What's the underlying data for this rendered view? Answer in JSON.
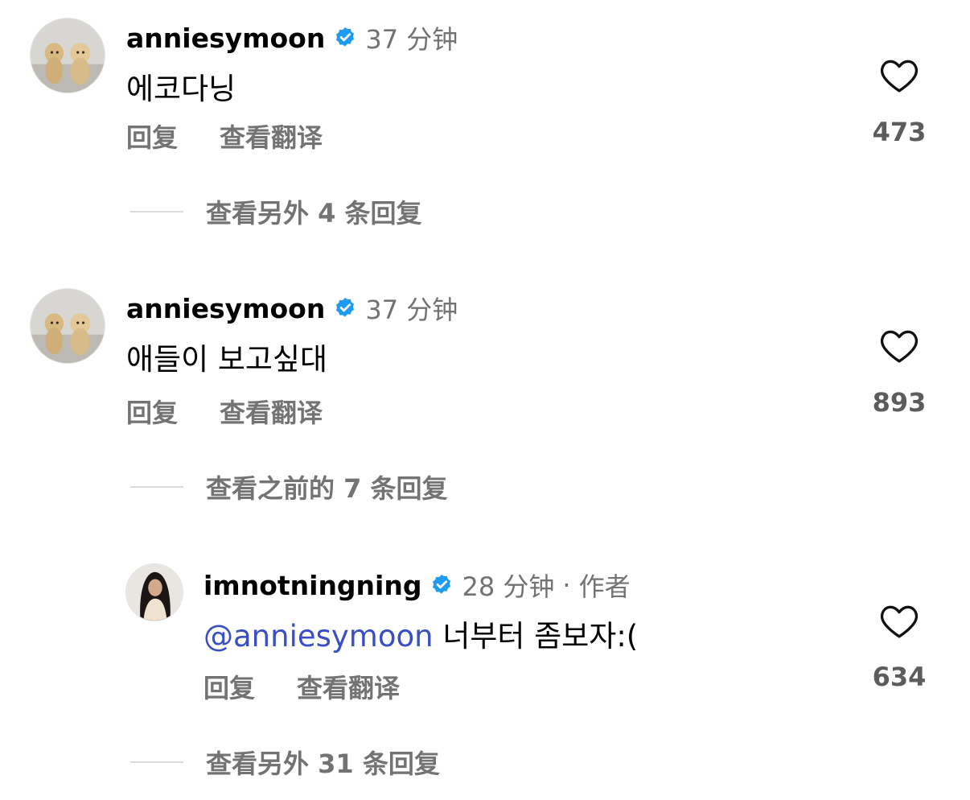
{
  "comments": [
    {
      "username": "anniesymoon",
      "time": "37 分钟",
      "text": "에코다닝",
      "actions": {
        "reply": "回复",
        "translate": "查看翻译"
      },
      "likes": "473",
      "replies_toggle": "查看另外 4 条回复"
    },
    {
      "username": "anniesymoon",
      "time": "37 分钟",
      "text": "애들이 보고싶대",
      "actions": {
        "reply": "回复",
        "translate": "查看翻译"
      },
      "likes": "893",
      "replies_toggle": "查看之前的 7 条回复"
    },
    {
      "username": "imnotningning",
      "time": "28 分钟",
      "separator": "·",
      "author_badge": "作者",
      "mention": "@anniesymoon",
      "text": "너부터 좀보자:(",
      "actions": {
        "reply": "回复",
        "translate": "查看翻译"
      },
      "likes": "634",
      "replies_toggle": "查看另外 31 条回复"
    }
  ],
  "icons": {
    "verified": "verified-badge-icon",
    "like": "heart-icon"
  },
  "colors": {
    "verified": "#1d9bf0",
    "mention": "#3a4fc4",
    "secondary_text": "#737373"
  }
}
